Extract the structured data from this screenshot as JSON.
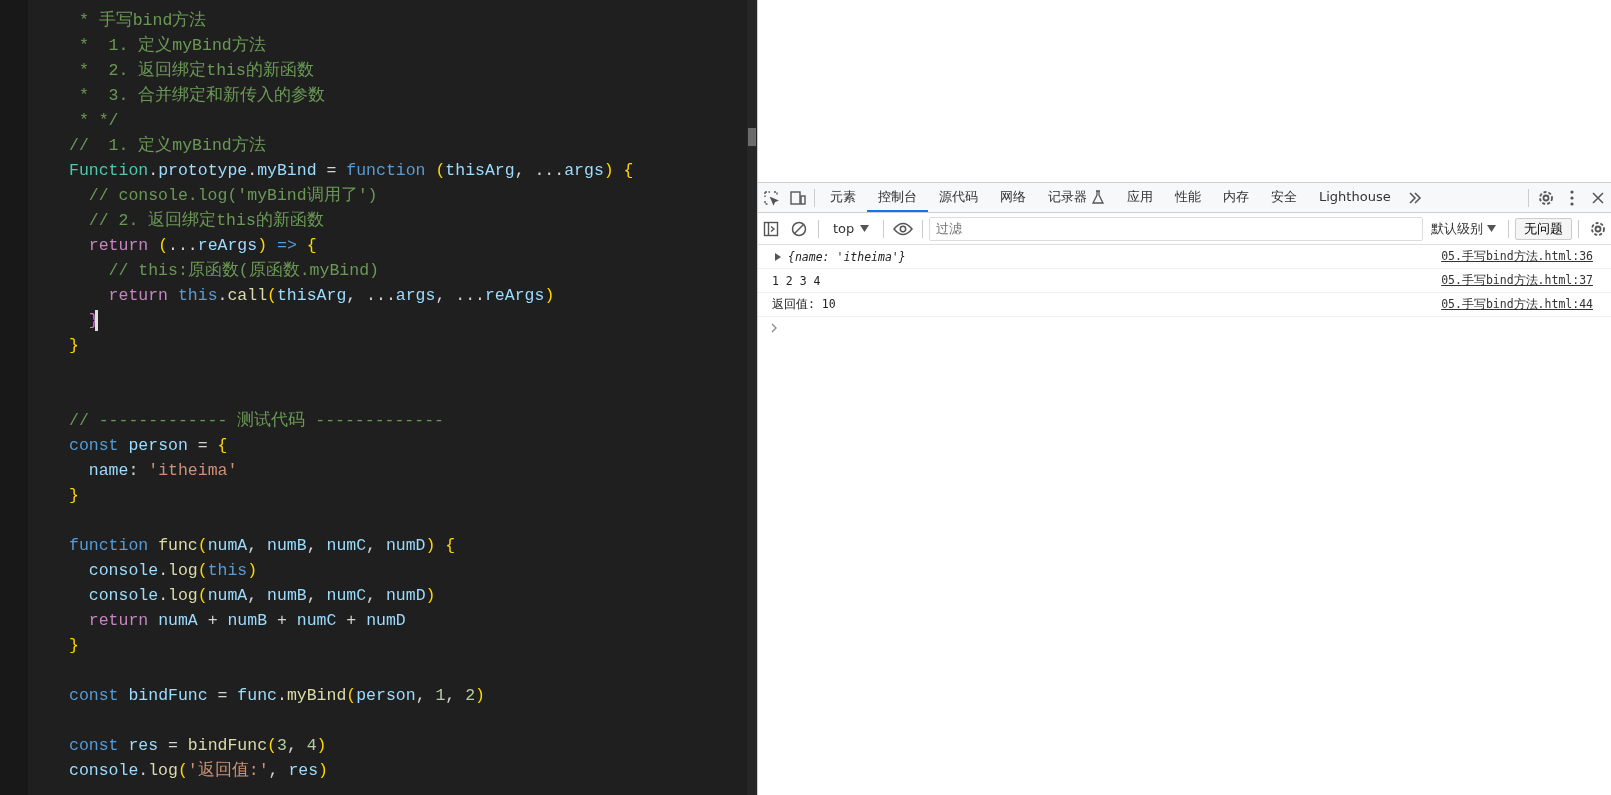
{
  "editor": {
    "lines": [
      {
        "kind": "code",
        "text": " * 手写bind方法"
      },
      {
        "kind": "code",
        "text": " *  1. 定义myBind方法"
      },
      {
        "kind": "code",
        "text": " *  2. 返回绑定this的新函数"
      },
      {
        "kind": "code",
        "text": " *  3. 合并绑定和新传入的参数"
      },
      {
        "kind": "code",
        "text": " * */"
      },
      {
        "kind": "code",
        "text": "//  1. 定义myBind方法"
      },
      {
        "kind": "code",
        "text": "Function.prototype.myBind = function (thisArg, ...args) {"
      },
      {
        "kind": "code",
        "text": "  // console.log('myBind调用了')"
      },
      {
        "kind": "code",
        "text": "  // 2. 返回绑定this的新函数"
      },
      {
        "kind": "code",
        "text": "  return (...reArgs) => {"
      },
      {
        "kind": "code",
        "text": "    // this:原函数(原函数.myBind)"
      },
      {
        "kind": "code",
        "text": "    return this.call(thisArg, ...args, ...reArgs)"
      },
      {
        "kind": "code",
        "cursor": true,
        "text": "  }"
      },
      {
        "kind": "code",
        "text": "}"
      },
      {
        "kind": "blank"
      },
      {
        "kind": "blank"
      },
      {
        "kind": "code",
        "text": "// ------------- 测试代码 -------------"
      },
      {
        "kind": "code",
        "text": "const person = {"
      },
      {
        "kind": "code",
        "text": "  name: 'itheima'"
      },
      {
        "kind": "code",
        "text": "}"
      },
      {
        "kind": "blank"
      },
      {
        "kind": "code",
        "text": "function func(numA, numB, numC, numD) {"
      },
      {
        "kind": "code",
        "text": "  console.log(this)"
      },
      {
        "kind": "code",
        "text": "  console.log(numA, numB, numC, numD)"
      },
      {
        "kind": "code",
        "text": "  return numA + numB + numC + numD"
      },
      {
        "kind": "code",
        "text": "}"
      },
      {
        "kind": "blank"
      },
      {
        "kind": "code",
        "text": "const bindFunc = func.myBind(person, 1, 2)"
      },
      {
        "kind": "blank"
      },
      {
        "kind": "code",
        "text": "const res = bindFunc(3, 4)"
      },
      {
        "kind": "code",
        "text": "console.log('返回值:', res)"
      }
    ]
  },
  "devtools": {
    "tabs": [
      {
        "label": "元素",
        "selected": false,
        "kind": "plain"
      },
      {
        "label": "控制台",
        "selected": true,
        "kind": "plain"
      },
      {
        "label": "源代码",
        "selected": false,
        "kind": "plain"
      },
      {
        "label": "网络",
        "selected": false,
        "kind": "plain"
      },
      {
        "label": "记录器",
        "selected": false,
        "kind": "experimental"
      },
      {
        "label": "应用",
        "selected": false,
        "kind": "plain"
      },
      {
        "label": "性能",
        "selected": false,
        "kind": "plain"
      },
      {
        "label": "内存",
        "selected": false,
        "kind": "plain"
      },
      {
        "label": "安全",
        "selected": false,
        "kind": "plain"
      },
      {
        "label": "Lighthouse",
        "selected": false,
        "kind": "plain"
      }
    ],
    "toolbar": {
      "context": "top",
      "filter_placeholder": "过滤",
      "level": "默认级别",
      "issues": "无问题"
    },
    "messages": [
      {
        "kind": "object",
        "expanded": false,
        "text": "{name: 'itheima'}",
        "source": "05.手写bind方法.html:36"
      },
      {
        "kind": "text",
        "text": "1 2 3 4",
        "source": "05.手写bind方法.html:37"
      },
      {
        "kind": "text",
        "text": "返回值: 10",
        "source": "05.手写bind方法.html:44"
      }
    ]
  }
}
